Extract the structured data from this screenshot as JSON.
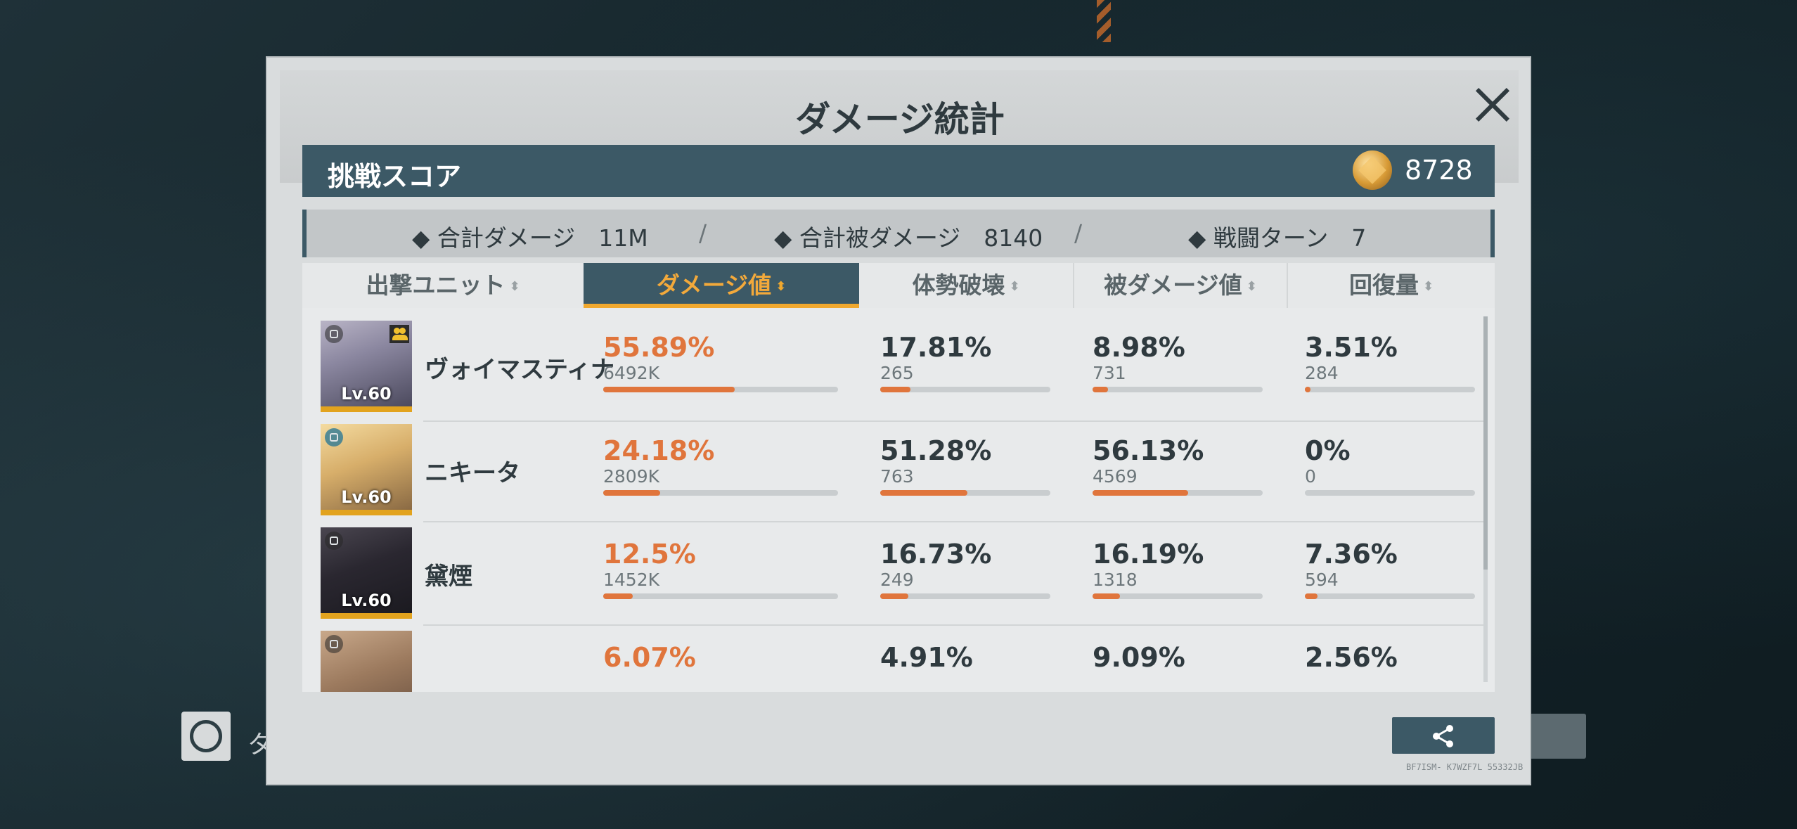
{
  "background": {
    "left_button_text": "タ"
  },
  "dialog": {
    "title": "ダメージ統計",
    "close_icon": "close-icon"
  },
  "score": {
    "label": "挑戦スコア",
    "value": "8728",
    "icon": "medal-icon"
  },
  "summary": {
    "total_damage": "◆ 合計ダメージ　11M",
    "total_damage_taken": "◆ 合計被ダメージ　8140",
    "battle_turns": "◆ 戦闘ターン　7",
    "separator": "/"
  },
  "columns": [
    {
      "label": "出撃ユニット",
      "active": false
    },
    {
      "label": "ダメージ値",
      "active": true
    },
    {
      "label": "体勢破壊",
      "active": false
    },
    {
      "label": "被ダメージ値",
      "active": false
    },
    {
      "label": "回復量",
      "active": false
    }
  ],
  "units": [
    {
      "name": "ヴォイマスティナ",
      "level": "Lv.60",
      "support": true,
      "damage": {
        "pct": "55.89%",
        "raw": "6492K",
        "fraction": 0.5589
      },
      "break": {
        "pct": "17.81%",
        "raw": "265",
        "fraction": 0.1781
      },
      "taken": {
        "pct": "8.98%",
        "raw": "731",
        "fraction": 0.0898
      },
      "heal": {
        "pct": "3.51%",
        "raw": "284",
        "fraction": 0.0351
      }
    },
    {
      "name": "ニキータ",
      "level": "Lv.60",
      "support": false,
      "damage": {
        "pct": "24.18%",
        "raw": "2809K",
        "fraction": 0.2418
      },
      "break": {
        "pct": "51.28%",
        "raw": "763",
        "fraction": 0.5128
      },
      "taken": {
        "pct": "56.13%",
        "raw": "4569",
        "fraction": 0.5613
      },
      "heal": {
        "pct": "0%",
        "raw": "0",
        "fraction": 0
      }
    },
    {
      "name": "黛煙",
      "level": "Lv.60",
      "support": false,
      "damage": {
        "pct": "12.5%",
        "raw": "1452K",
        "fraction": 0.125
      },
      "break": {
        "pct": "16.73%",
        "raw": "249",
        "fraction": 0.1673
      },
      "taken": {
        "pct": "16.19%",
        "raw": "1318",
        "fraction": 0.1619
      },
      "heal": {
        "pct": "7.36%",
        "raw": "594",
        "fraction": 0.0736
      }
    },
    {
      "name": "",
      "level": "",
      "support": false,
      "damage": {
        "pct": "6.07%",
        "raw": "",
        "fraction": 0.0607
      },
      "break": {
        "pct": "4.91%",
        "raw": "",
        "fraction": 0.0491
      },
      "taken": {
        "pct": "9.09%",
        "raw": "",
        "fraction": 0.0909
      },
      "heal": {
        "pct": "2.56%",
        "raw": "",
        "fraction": 0.0256
      }
    }
  ],
  "share": {
    "icon": "share-icon"
  },
  "footer_code": "BF7ISM- K7WZF7L 55332JB",
  "colors": {
    "accent_orange": "#e0753c",
    "header_blue": "#3c5966",
    "active_tab_text": "#f2a93b",
    "gold_border": "#e2a31e"
  }
}
